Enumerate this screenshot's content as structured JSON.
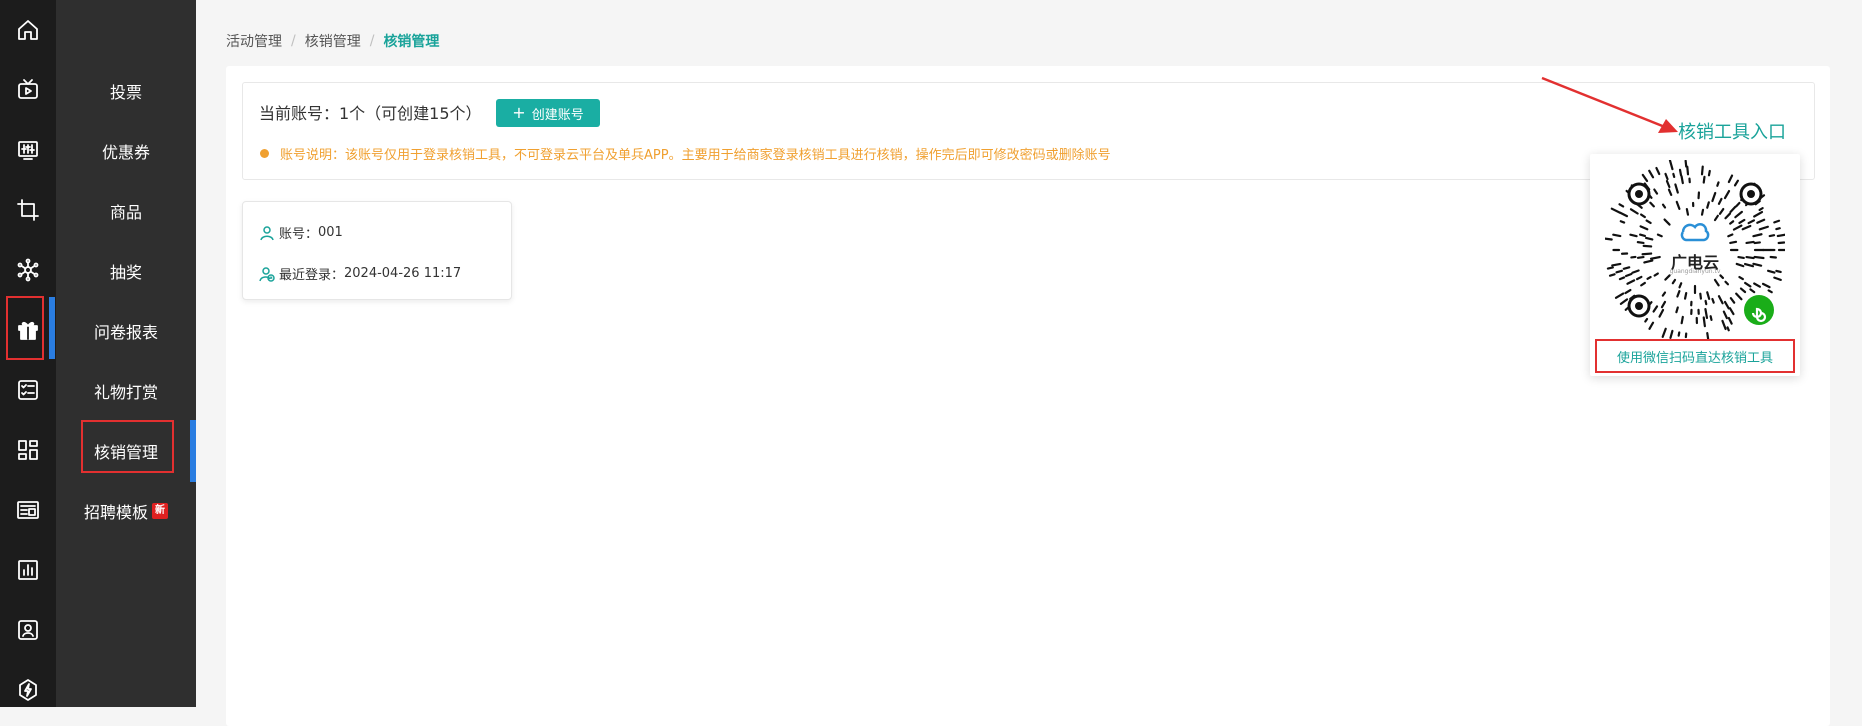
{
  "rail_icons": [
    "home-icon",
    "tv-icon",
    "sliders-icon",
    "crop-icon",
    "network-icon",
    "gift-icon",
    "checklist-icon",
    "grid-icon",
    "news-icon",
    "bar-chart-icon",
    "contact-card-icon",
    "lightning-shield-icon"
  ],
  "submenu": {
    "items": [
      {
        "label": "投票"
      },
      {
        "label": "优惠券"
      },
      {
        "label": "商品"
      },
      {
        "label": "抽奖"
      },
      {
        "label": "问卷报表"
      },
      {
        "label": "礼物打赏"
      },
      {
        "label": "核销管理"
      },
      {
        "label": "招聘模板"
      }
    ],
    "new_badge": "新"
  },
  "breadcrumb": {
    "items": [
      "活动管理",
      "核销管理"
    ],
    "current": "核销管理",
    "separator": "/"
  },
  "account": {
    "count_text": "当前账号：1个（可创建15个）",
    "create_button": "创建账号",
    "notice": "账号说明：该账号仅用于登录核销工具，不可登录云平台及单兵APP。主要用于给商家登录核销工具进行核销，操作完后即可修改密码或删除账号"
  },
  "account_card": {
    "account_label": "账号：",
    "account_value": "001",
    "last_login_label": "最近登录：",
    "last_login_value": "2024-04-26 11:17"
  },
  "tool_entry": {
    "link_label": "核销工具入口",
    "qr_brand": "广电云",
    "qr_brand_sub": "guangdianyun.tv",
    "qr_caption": "使用微信扫码直达核销工具"
  },
  "colors": {
    "accent": "#1aa39a",
    "warning": "#f0a030",
    "highlight": "#e23030",
    "active_bar": "#2a7de1"
  }
}
